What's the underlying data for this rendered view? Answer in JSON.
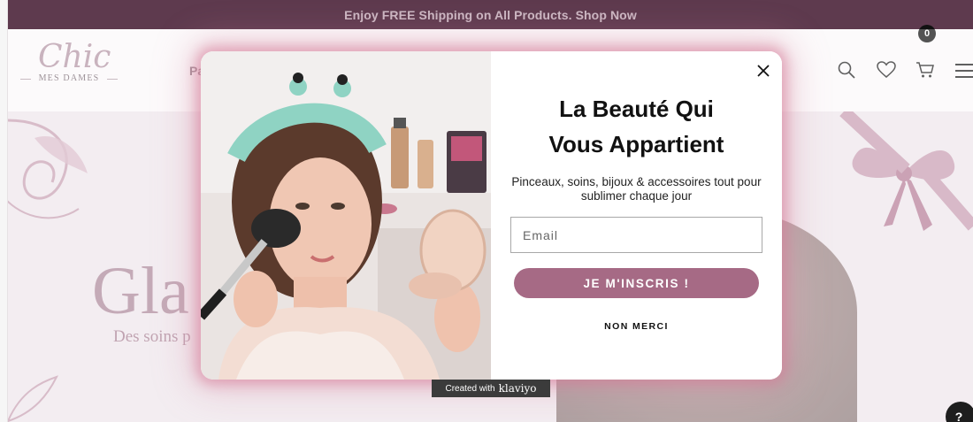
{
  "announcement": {
    "text": "Enjoy FREE Shipping on All Products. Shop Now"
  },
  "header": {
    "logo_script": "Chic",
    "logo_tagline": "MES DAMES",
    "nav_partial": "Pa",
    "cart_count": "0",
    "icons": [
      "search-icon",
      "heart-icon",
      "cart-icon",
      "menu-icon"
    ]
  },
  "hero": {
    "title_partial": "Gla",
    "subtitle_partial": "Des soins p"
  },
  "popup": {
    "title_line1": "La Beauté Qui",
    "title_line2": "Vous Appartient",
    "subtitle": "Pinceaux, soins, bijoux & accessoires tout pour sublimer chaque jour",
    "email_placeholder": "Email",
    "subscribe_label": "JE M'INSCRIS !",
    "decline_label": "NON MERCI",
    "accent_color": "#a66a85"
  },
  "badge": {
    "created_with": "Created with",
    "brand": "klaviyo"
  },
  "help": {
    "label": "?"
  },
  "colors": {
    "announcement_bg": "#5e3a4e",
    "hero_accent": "#7a3d5a"
  }
}
